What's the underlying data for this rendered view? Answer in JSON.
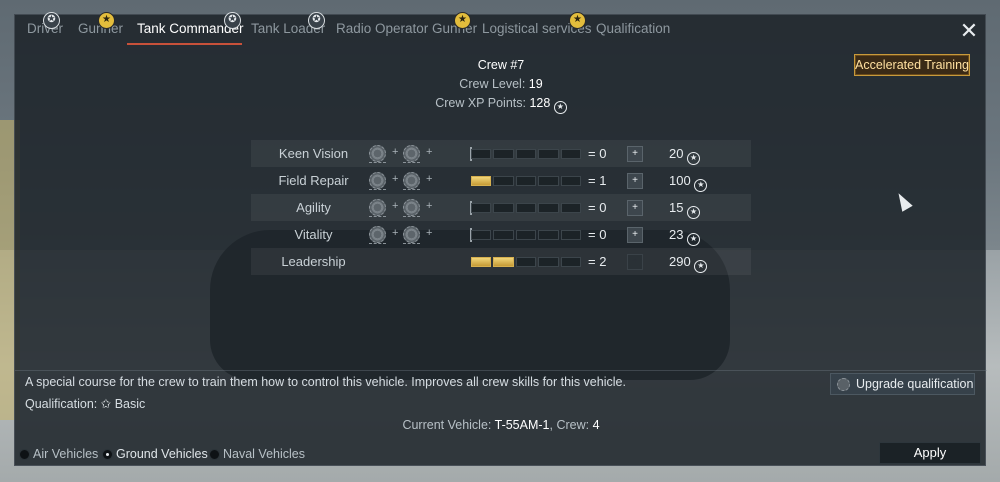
{
  "tabs": [
    {
      "label": "Driver",
      "badge": "gray"
    },
    {
      "label": "Gunner",
      "badge": "gold"
    },
    {
      "label": "Tank Commander",
      "badge": "gray",
      "active": true
    },
    {
      "label": "Tank Loader",
      "badge": "gray"
    },
    {
      "label": "Radio Operator Gunner",
      "badge": "gold"
    },
    {
      "label": "Logistical services",
      "badge": "gold"
    },
    {
      "label": "Qualification",
      "badge": null
    }
  ],
  "crew": {
    "title": "Crew #7",
    "level_label": "Crew Level:",
    "level_value": "19",
    "xp_label": "Crew XP Points:",
    "xp_value": "128"
  },
  "accelerated_training_label": "Accelerated Training",
  "skills": [
    {
      "name": "Keen Vision",
      "filled": 0,
      "eq": "= 0",
      "cost": "20",
      "gears": true,
      "plus_enabled": true
    },
    {
      "name": "Field Repair",
      "filled": 1,
      "eq": "= 1",
      "cost": "100",
      "gears": true,
      "plus_enabled": true
    },
    {
      "name": "Agility",
      "filled": 0,
      "eq": "= 0",
      "cost": "15",
      "gears": true,
      "plus_enabled": true
    },
    {
      "name": "Vitality",
      "filled": 0,
      "eq": "= 0",
      "cost": "23",
      "gears": true,
      "plus_enabled": true
    },
    {
      "name": "Leadership",
      "filled": 2,
      "eq": "= 2",
      "cost": "290",
      "gears": false,
      "plus_enabled": false
    }
  ],
  "description": "A special course for the crew to train them how to control this vehicle. Improves all crew skills for this vehicle.",
  "qualification": {
    "label": "Qualification:",
    "value": "Basic"
  },
  "upgrade_label": "Upgrade qualification",
  "vehicle": {
    "label": "Current Vehicle:",
    "name": "T-55AM-1",
    "crew_label": ", Crew:",
    "crew_value": "4"
  },
  "filters": [
    {
      "label": "Air Vehicles",
      "selected": false
    },
    {
      "label": "Ground Vehicles",
      "selected": true
    },
    {
      "label": "Naval Vehicles",
      "selected": false
    }
  ],
  "apply_label": "Apply",
  "icons": {
    "close": "close-icon",
    "xp": "crew-xp-icon",
    "plus": "plus-icon"
  }
}
